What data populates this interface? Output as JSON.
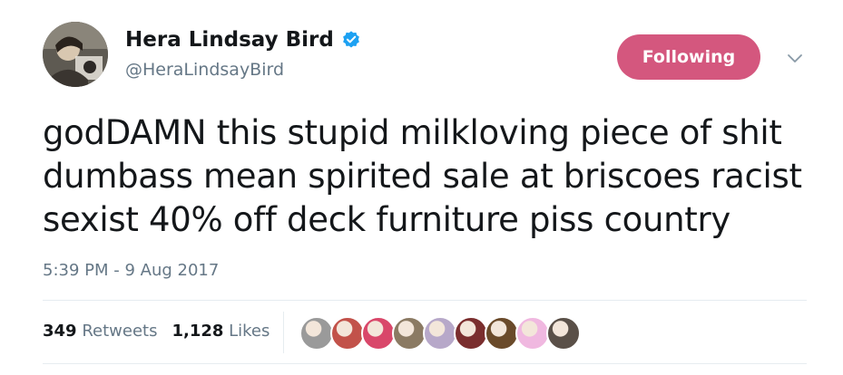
{
  "author": {
    "display_name": "Hera Lindsay Bird",
    "handle": "@HeraLindsayBird",
    "verified": true
  },
  "follow_button": {
    "label": "Following",
    "color": "#d4577e"
  },
  "tweet": {
    "text_lines": [
      "godDAMN this stupid milkloving piece of shit",
      "dumbass mean spirited sale at briscoes racist",
      "sexist 40% off deck furniture piss country"
    ],
    "timestamp": "5:39 PM - 9 Aug 2017"
  },
  "stats": {
    "retweets_count": "349",
    "retweets_label": "Retweets",
    "likes_count": "1,128",
    "likes_label": "Likes"
  },
  "liker_avatars": [
    {
      "name": "liker-avatar-1",
      "color": "#9a9a9a"
    },
    {
      "name": "liker-avatar-2",
      "color": "#c2524a"
    },
    {
      "name": "liker-avatar-3",
      "color": "#d9476a"
    },
    {
      "name": "liker-avatar-4",
      "color": "#8b7a63"
    },
    {
      "name": "liker-avatar-5",
      "color": "#b7a8c9"
    },
    {
      "name": "liker-avatar-6",
      "color": "#7a2e2e"
    },
    {
      "name": "liker-avatar-7",
      "color": "#6a4a2a"
    },
    {
      "name": "liker-avatar-8",
      "color": "#f0b8e0"
    },
    {
      "name": "liker-avatar-9",
      "color": "#5a5048"
    }
  ],
  "colors": {
    "text_primary": "#14171a",
    "text_secondary": "#657786",
    "verified_blue": "#1da1f2",
    "divider": "#e6ecf0"
  }
}
